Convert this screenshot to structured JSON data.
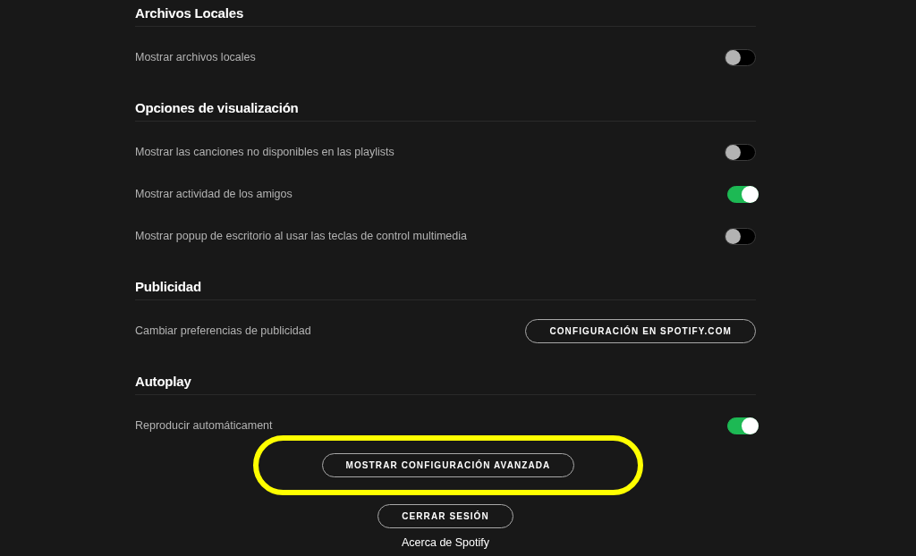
{
  "sections": [
    {
      "title": "Archivos Locales",
      "rows": [
        {
          "kind": "toggle",
          "label": "Mostrar archivos locales",
          "on": false
        }
      ]
    },
    {
      "title": "Opciones de visualización",
      "rows": [
        {
          "kind": "toggle",
          "label": "Mostrar las canciones no disponibles en las playlists",
          "on": false
        },
        {
          "kind": "toggle",
          "label": "Mostrar actividad de los amigos",
          "on": true
        },
        {
          "kind": "toggle",
          "label": "Mostrar popup de escritorio al usar las teclas de control multimedia",
          "on": false
        }
      ]
    },
    {
      "title": "Publicidad",
      "rows": [
        {
          "kind": "button",
          "label": "Cambiar preferencias de publicidad",
          "button": "CONFIGURACIÓN EN SPOTIFY.COM"
        }
      ]
    },
    {
      "title": "Autoplay",
      "rows": [
        {
          "kind": "toggle",
          "label": "Reproducir automáticament",
          "on": true
        }
      ]
    }
  ],
  "footer_buttons": [
    {
      "label": "MOSTRAR CONFIGURACIÓN AVANZADA",
      "highlighted": true
    },
    {
      "label": "CERRAR SESIÓN",
      "highlighted": false
    }
  ],
  "about_link": "Acerca de Spotify"
}
